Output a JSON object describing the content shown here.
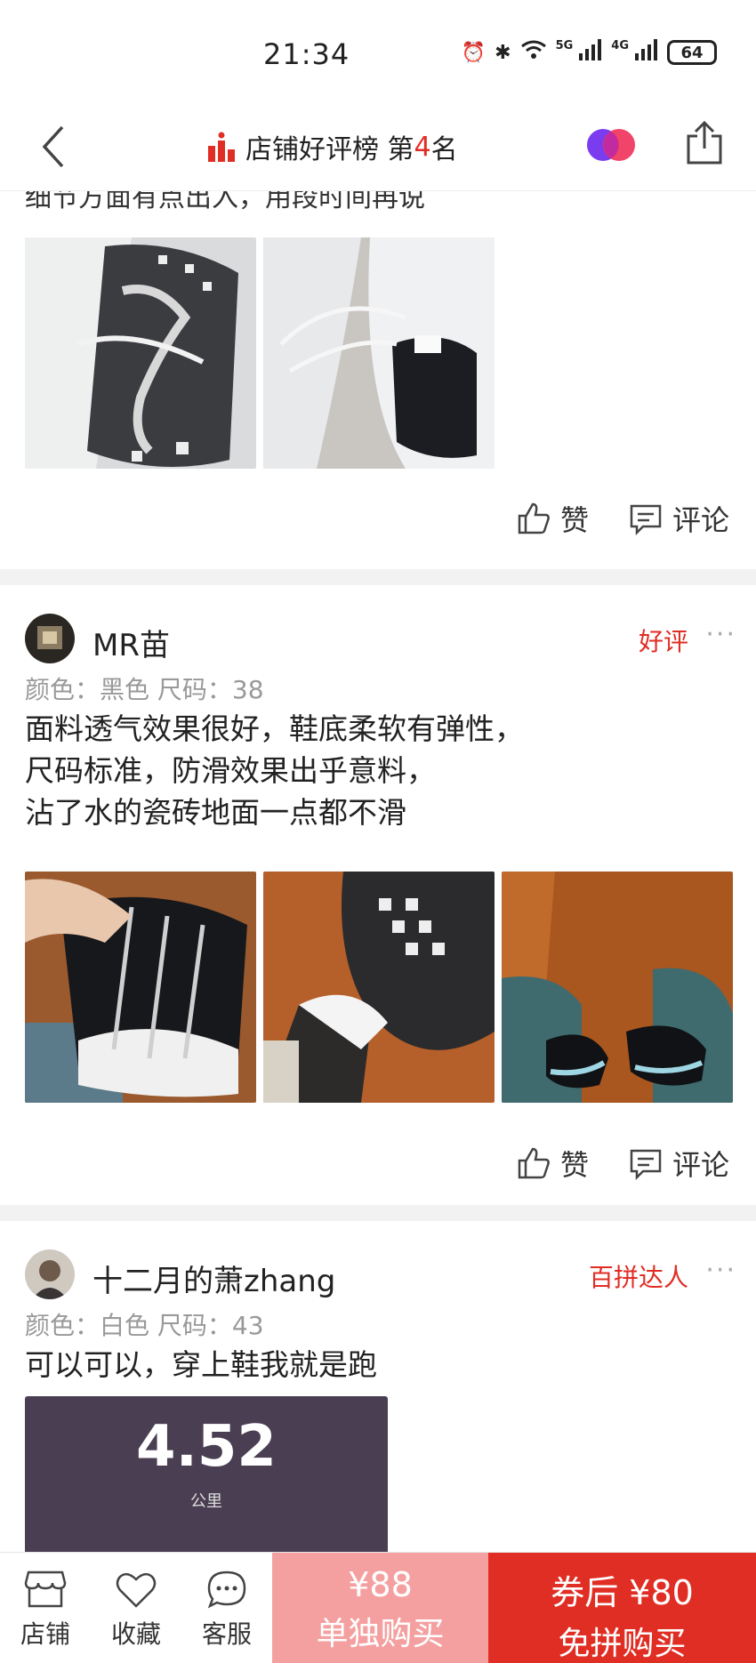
{
  "status_bar": {
    "time": "21:34",
    "network_5g": "5G",
    "network_4g": "4G",
    "battery": "64"
  },
  "header": {
    "title_prefix": "店铺好评榜 第",
    "rank": "4",
    "title_suffix": "名"
  },
  "reviews": [
    {
      "partial_text": "细节方面有点出入，用段时间再说",
      "photos": [
        "white-shoe-sole",
        "white-shoe-insole"
      ],
      "like_label": "赞",
      "comment_label": "评论"
    },
    {
      "user": "MR苗",
      "badge": "好评",
      "more": "···",
      "spec": "颜色：黑色  尺码：38",
      "text_lines": [
        "面料透气效果很好，鞋底柔软有弹性，",
        "尺码标准，防滑效果出乎意料，",
        "沾了水的瓷砖地面一点都不滑"
      ],
      "photos": [
        "black-shoe-hand",
        "black-shoe-sole",
        "black-shoes-worn"
      ],
      "like_label": "赞",
      "comment_label": "评论"
    },
    {
      "user": "十二月的萧zhang",
      "badge": "百拼达人",
      "more": "···",
      "spec": "颜色：白色  尺码：43",
      "text": "可以可以，穿上鞋我就是跑",
      "run_distance": "4.52",
      "run_unit": "公里"
    }
  ],
  "bottom_bar": {
    "store_label": "店铺",
    "favorite_label": "收藏",
    "service_label": "客服",
    "solo_price": "¥88",
    "solo_label": "单独购买",
    "group_price": "券后 ¥80",
    "group_label": "免拼购买"
  },
  "colors": {
    "accent": "#e02e24",
    "solo_button": "#f5a0a0",
    "divider": "#f2f2f2"
  }
}
